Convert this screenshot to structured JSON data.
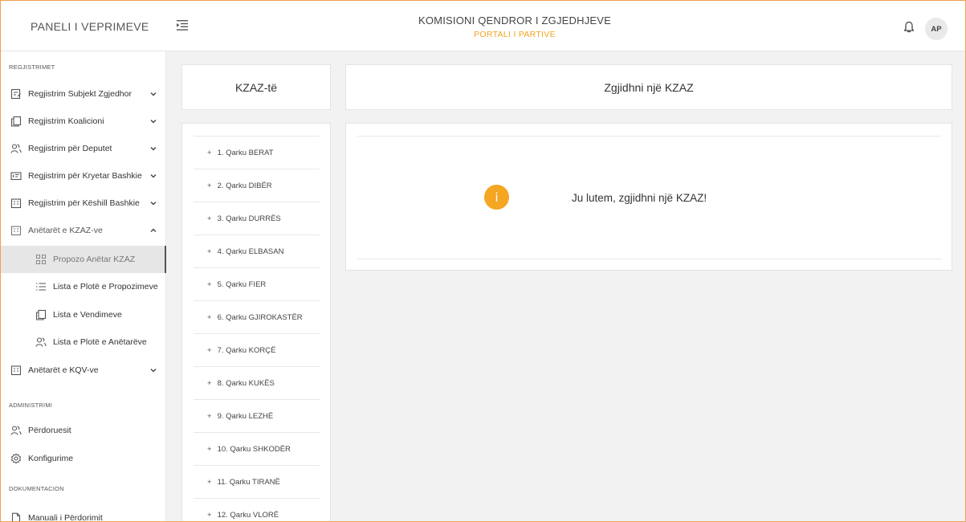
{
  "header": {
    "brand": "PANELI I VEPRIMEVE",
    "title": "KOMISIONI QENDROR I ZGJEDHJEVE",
    "subtitle": "PORTALI I PARTIVE",
    "avatar": "AP"
  },
  "sidebar": {
    "sections": {
      "regjistrimet": "REGJISTRIMET",
      "administrimi": "ADMINISTRIMI",
      "dokumentacion": "DOKUMENTACION"
    },
    "items": [
      {
        "label": "Regjistrim Subjekt Zgjedhor",
        "icon": "form-icon"
      },
      {
        "label": "Regjistrim Koalicioni",
        "icon": "copy-icon"
      },
      {
        "label": "Regjistrim për Deputet",
        "icon": "users-icon"
      },
      {
        "label": "Regjistrim për Kryetar Bashkie",
        "icon": "id-card-icon"
      },
      {
        "label": "Regjistrim për Këshill Bashkie",
        "icon": "building-icon"
      },
      {
        "label": "Anëtarët e KZAZ-ve",
        "icon": "building-icon"
      },
      {
        "label": "Propozo Anëtar KZAZ",
        "icon": "grid-icon"
      },
      {
        "label": "Lista e Plotë e Propozimeve",
        "icon": "list-icon"
      },
      {
        "label": "Lista e Vendimeve",
        "icon": "copy-icon"
      },
      {
        "label": "Lista e Plotë e Anëtarëve",
        "icon": "users-icon"
      },
      {
        "label": "Anëtarët e KQV-ve",
        "icon": "building-icon"
      },
      {
        "label": "Përdoruesit",
        "icon": "users-icon"
      },
      {
        "label": "Konfigurime",
        "icon": "gear-icon"
      },
      {
        "label": "Manuali i Përdorimit",
        "icon": "document-icon"
      }
    ]
  },
  "kzaz": {
    "heading": "KZAZ-të",
    "items": [
      "1. Qarku BERAT",
      "2. Qarku DIBËR",
      "3. Qarku DURRËS",
      "4. Qarku ELBASAN",
      "5. Qarku FIER",
      "6. Qarku GJIROKASTËR",
      "7. Qarku KORÇË",
      "8. Qarku KUKËS",
      "9. Qarku LEZHË",
      "10. Qarku SHKODËR",
      "11. Qarku TIRANË",
      "12. Qarku VLORË"
    ],
    "plus": "+"
  },
  "main": {
    "heading": "Zgjidhni një KZAZ",
    "message": "Ju lutem, zgjidhni një KZAZ!",
    "info_glyph": "i"
  },
  "colors": {
    "accent": "#f4a321",
    "frame": "#f0a055"
  }
}
